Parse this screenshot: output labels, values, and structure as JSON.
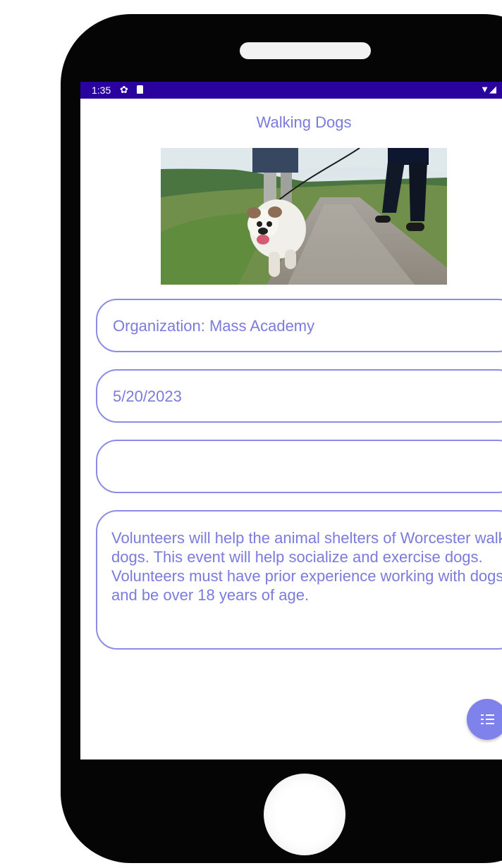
{
  "status_bar": {
    "time": "1:35",
    "settings_icon": "gear-icon",
    "sd_icon": "sd-card-icon",
    "wifi_icon": "wifi-icon",
    "background_color": "#2a039e"
  },
  "event": {
    "title": "Walking Dogs",
    "photo_icon": "dog-walking-photo",
    "organization": "Organization: Mass Academy",
    "date": "5/20/2023",
    "empty_field_value": "",
    "description": "Volunteers will help the animal shelters of Worcester walk dogs. This event will help socialize and exercise dogs. Volunteers must have prior experience working with dogs and be over 18 years of age."
  },
  "fab": {
    "icon": "list-icon",
    "color": "#7e82ea"
  },
  "theme": {
    "accent_text": "#7b7bdc",
    "field_border": "#8c8ce6"
  }
}
